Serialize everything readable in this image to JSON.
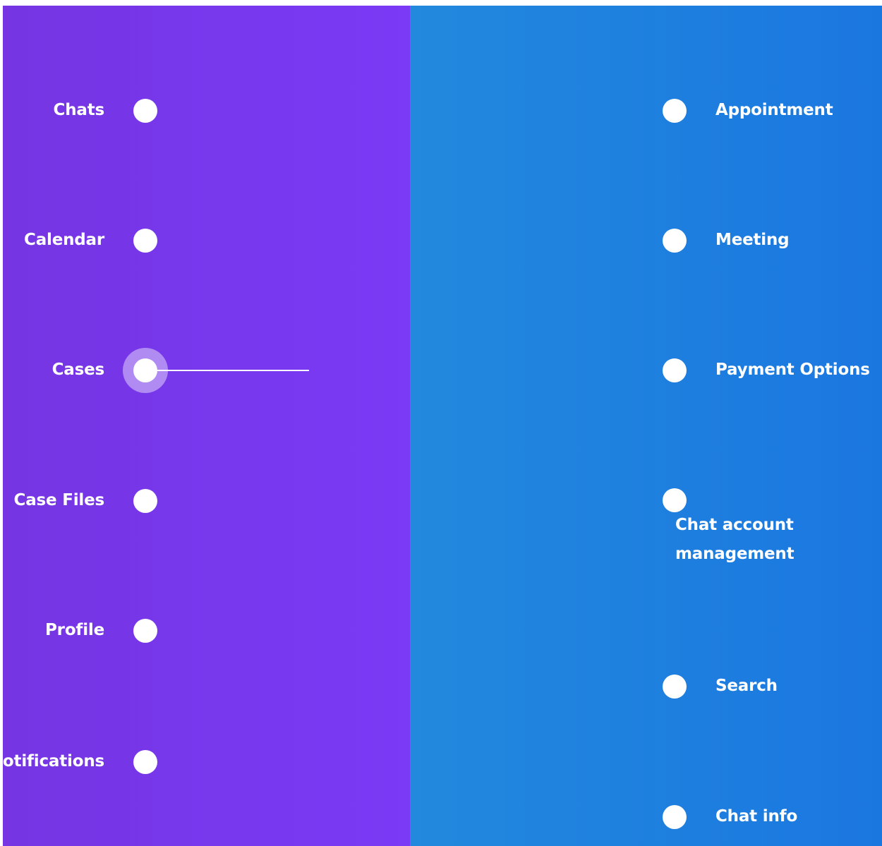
{
  "left_menu": {
    "items": [
      {
        "label": "Chats"
      },
      {
        "label": "Calendar"
      },
      {
        "label": "Cases"
      },
      {
        "label": "Case Files"
      },
      {
        "label": "Profile"
      },
      {
        "label": "Notifications"
      }
    ],
    "active_index": 2
  },
  "right_menu": {
    "items": [
      {
        "label": "Appointment"
      },
      {
        "label": "Meeting"
      },
      {
        "label": "Payment Options"
      },
      {
        "label_line1": "Chat account",
        "label_line2": "management"
      },
      {
        "label": "Search"
      },
      {
        "label": "Chat info"
      }
    ]
  },
  "colors": {
    "left_panel": "#7a3af6",
    "right_panel": "#1e80df",
    "dot": "#ffffff",
    "text": "#ffffff"
  }
}
